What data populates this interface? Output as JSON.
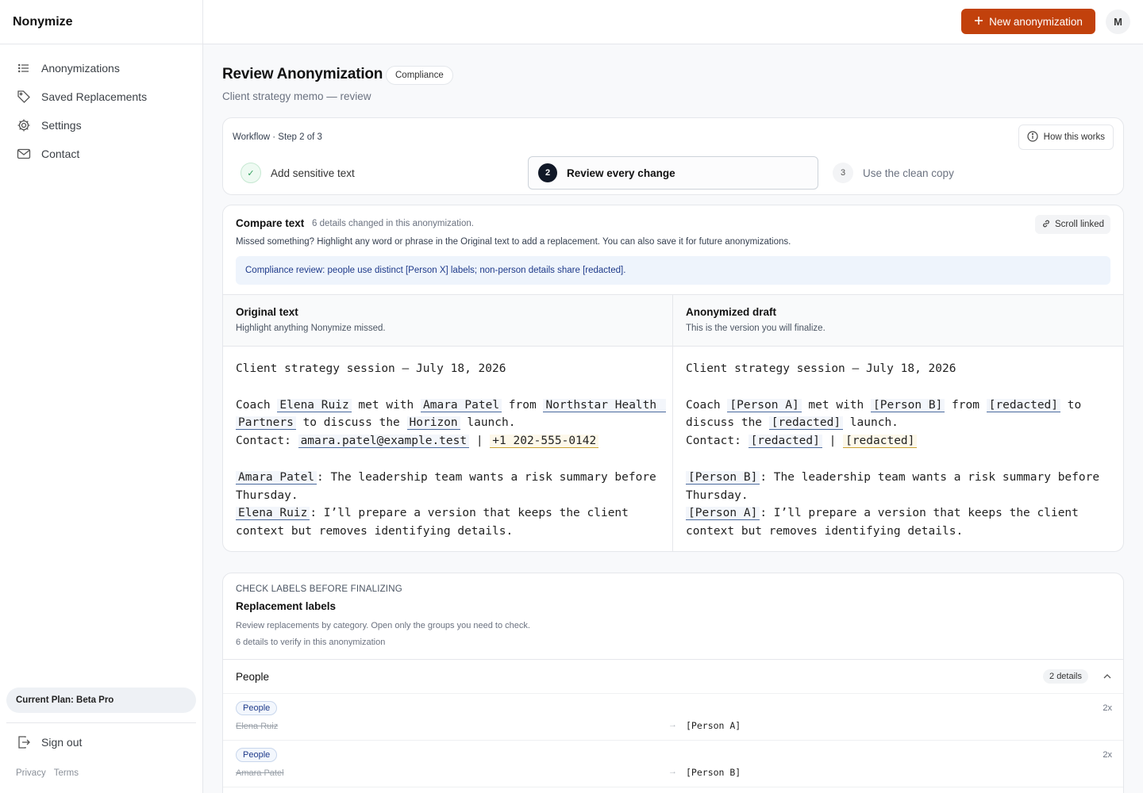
{
  "brand": "Nonymize",
  "nav": [
    {
      "label": "Anonymizations",
      "icon": "list-icon"
    },
    {
      "label": "Saved Replacements",
      "icon": "tag-icon"
    },
    {
      "label": "Settings",
      "icon": "gear-icon"
    },
    {
      "label": "Contact",
      "icon": "mail-icon"
    }
  ],
  "plan": "Current Plan: Beta Pro",
  "sign_out": "Sign out",
  "legal": {
    "privacy": "Privacy",
    "terms": "Terms"
  },
  "header": {
    "new_button": "New anonymization",
    "avatar": "M"
  },
  "page": {
    "title": "Review Anonymization",
    "badge": "Compliance",
    "subtitle": "Client strategy memo — review"
  },
  "workflow": {
    "label": "Workflow · Step 2 of 3",
    "help": "How this works",
    "steps": [
      {
        "num": "✓",
        "label": "Add sensitive text",
        "state": "done"
      },
      {
        "num": "2",
        "label": "Review every change",
        "state": "current"
      },
      {
        "num": "3",
        "label": "Use the clean copy",
        "state": "upcoming"
      }
    ]
  },
  "compare": {
    "title": "Compare text",
    "count": "6 details changed in this anonymization.",
    "description": "Missed something? Highlight any word or phrase in the Original text to add a replacement. You can also save it for future anonymizations.",
    "scroll": "Scroll linked",
    "notice": "Compliance review: people use distinct [Person X] labels; non-person details share [redacted].",
    "original": {
      "title": "Original text",
      "subtitle": "Highlight anything Nonymize missed."
    },
    "draft": {
      "title": "Anonymized draft",
      "subtitle": "This is the version you will finalize."
    },
    "original_lines": [
      [
        {
          "t": "Client strategy session — July 18, 2026"
        }
      ],
      [],
      [
        {
          "t": "Coach "
        },
        {
          "t": "Elena Ruiz",
          "h": "b"
        },
        {
          "t": " met with "
        },
        {
          "t": "Amara Patel",
          "h": "b"
        },
        {
          "t": " from "
        },
        {
          "t": "Northstar Health ",
          "h": "b"
        }
      ],
      [
        {
          "t": "Partners",
          "h": "b"
        },
        {
          "t": " to discuss the "
        },
        {
          "t": "Horizon",
          "h": "b"
        },
        {
          "t": " launch."
        }
      ],
      [
        {
          "t": "Contact: "
        },
        {
          "t": "amara.patel@example.test",
          "h": "b"
        },
        {
          "t": " | "
        },
        {
          "t": "+1 202-555-0142",
          "h": "y"
        }
      ],
      [],
      [
        {
          "t": "Amara Patel",
          "h": "b"
        },
        {
          "t": ": The leadership team wants a risk summary before"
        }
      ],
      [
        {
          "t": "Thursday."
        }
      ],
      [
        {
          "t": "Elena Ruiz",
          "h": "b"
        },
        {
          "t": ": I’ll prepare a version that keeps the client"
        }
      ],
      [
        {
          "t": "context but removes identifying details."
        }
      ]
    ],
    "draft_lines": [
      [
        {
          "t": "Client strategy session — July 18, 2026"
        }
      ],
      [],
      [
        {
          "t": "Coach "
        },
        {
          "t": "[Person A]",
          "h": "b"
        },
        {
          "t": " met with "
        },
        {
          "t": "[Person B]",
          "h": "b"
        },
        {
          "t": " from "
        },
        {
          "t": "[redacted]",
          "h": "b"
        },
        {
          "t": " to"
        }
      ],
      [
        {
          "t": "discuss the "
        },
        {
          "t": "[redacted]",
          "h": "b"
        },
        {
          "t": " launch."
        }
      ],
      [
        {
          "t": "Contact: "
        },
        {
          "t": "[redacted]",
          "h": "b"
        },
        {
          "t": " | "
        },
        {
          "t": "[redacted]",
          "h": "y"
        }
      ],
      [],
      [
        {
          "t": "[Person B]",
          "h": "b"
        },
        {
          "t": ": The leadership team wants a risk summary before"
        }
      ],
      [
        {
          "t": "Thursday."
        }
      ],
      [
        {
          "t": "[Person A]",
          "h": "b"
        },
        {
          "t": ": I’ll prepare a version that keeps the client"
        }
      ],
      [
        {
          "t": "context but removes identifying details."
        }
      ]
    ]
  },
  "labels": {
    "overline": "CHECK LABELS BEFORE FINALIZING",
    "title": "Replacement labels",
    "description": "Review replacements by category. Open only the groups you need to check.",
    "count": "6 details to verify in this anonymization",
    "group": {
      "name": "People",
      "badge": "2 details"
    },
    "rows": [
      {
        "tag": "People",
        "original": "Elena Ruiz",
        "replacement": "[Person A]",
        "count": "2x"
      },
      {
        "tag": "People",
        "original": "Amara Patel",
        "replacement": "[Person B]",
        "count": "2x"
      }
    ]
  },
  "colors": {
    "accent": "#c2410c",
    "highlight": "#4b6b9e",
    "highlight_warn": "#cba233",
    "notice_bg": "#eef4fc"
  }
}
